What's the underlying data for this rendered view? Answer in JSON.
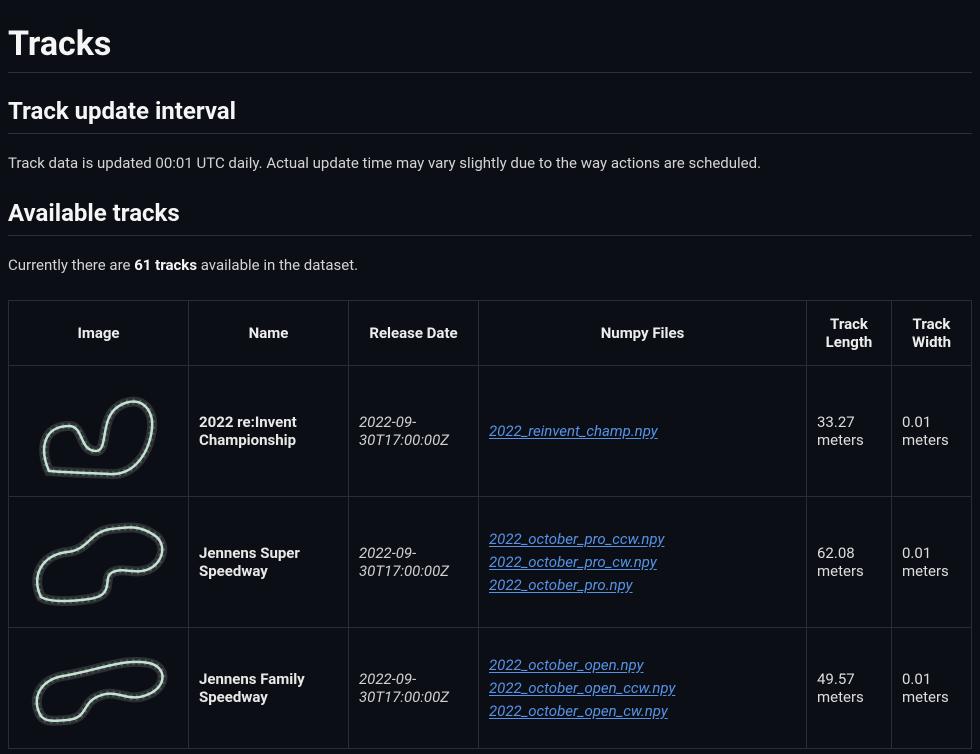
{
  "page": {
    "title": "Tracks",
    "update_heading": "Track update interval",
    "update_text": "Track data is updated 00:01 UTC daily. Actual update time may vary slightly due to the way actions are scheduled.",
    "available_heading": "Available tracks",
    "available_prefix": "Currently there are ",
    "available_count": "61 tracks",
    "available_suffix": " available in the dataset."
  },
  "table": {
    "headers": {
      "image": "Image",
      "name": "Name",
      "release": "Release Date",
      "npy": "Numpy Files",
      "length": "Track Length",
      "width": "Track Width"
    },
    "rows": [
      {
        "name": "2022 re:Invent Championship",
        "release": "2022-09-30T17:00:00Z",
        "npy": [
          "2022_reinvent_champ.npy"
        ],
        "length": "33.27 meters",
        "width": "0.01 meters"
      },
      {
        "name": "Jennens Super Speedway",
        "release": "2022-09-30T17:00:00Z",
        "npy": [
          "2022_october_pro_ccw.npy",
          "2022_october_pro_cw.npy",
          "2022_october_pro.npy"
        ],
        "length": "62.08 meters",
        "width": "0.01 meters"
      },
      {
        "name": "Jennens Family Speedway",
        "release": "2022-09-30T17:00:00Z",
        "npy": [
          "2022_october_open.npy",
          "2022_october_open_ccw.npy",
          "2022_october_open_cw.npy"
        ],
        "length": "49.57 meters",
        "width": "0.01 meters"
      }
    ]
  }
}
